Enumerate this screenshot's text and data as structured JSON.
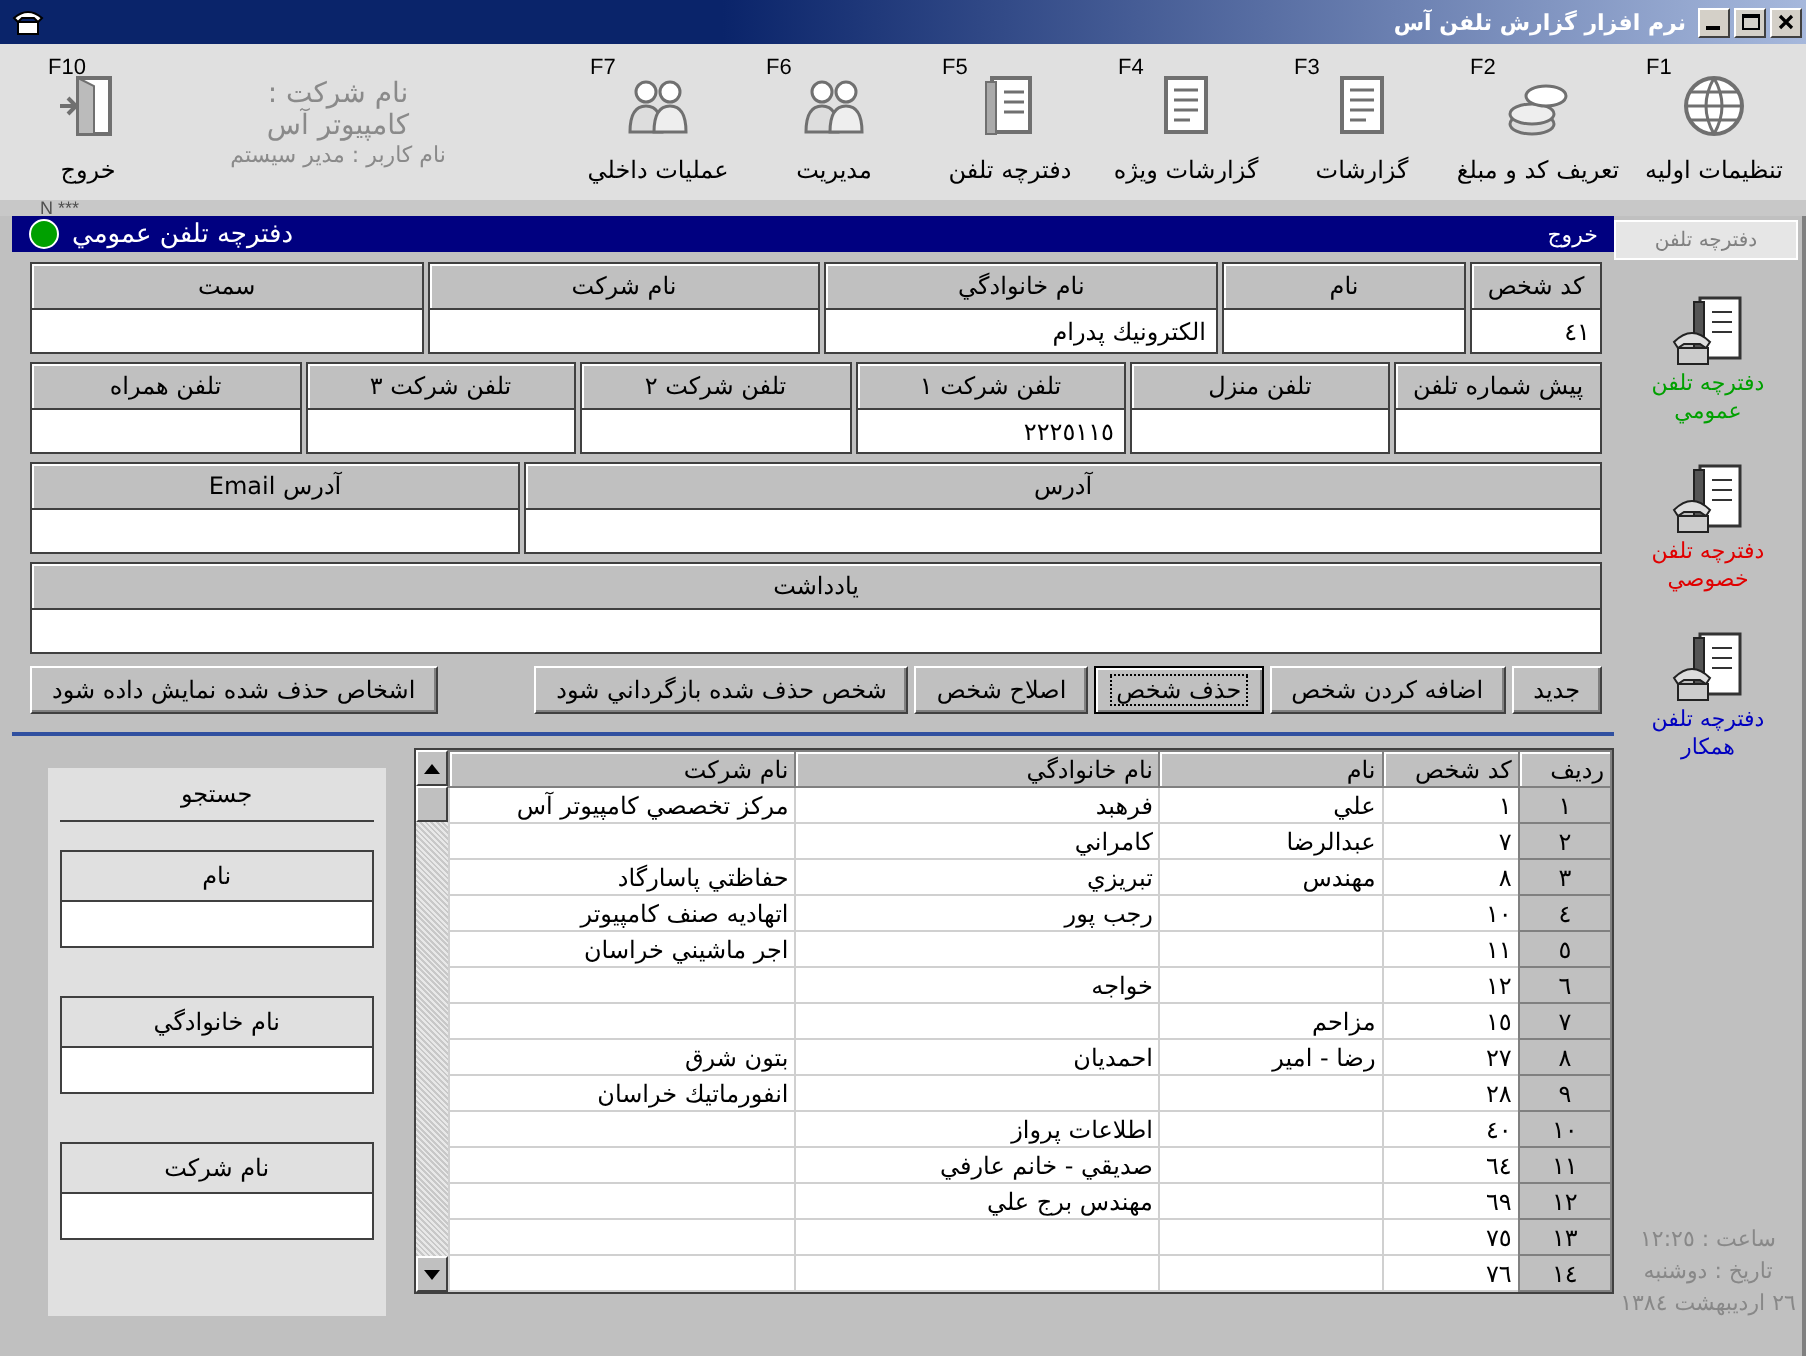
{
  "window": {
    "title": "نرم افزار گزارش تلفن آس"
  },
  "toolbar": {
    "items": [
      {
        "key": "F1",
        "label": "تنظيمات اوليه"
      },
      {
        "key": "F2",
        "label": "تعريف كد و مبلغ"
      },
      {
        "key": "F3",
        "label": "گزارشات"
      },
      {
        "key": "F4",
        "label": "گزارشات ويژه"
      },
      {
        "key": "F5",
        "label": "دفترچه تلفن"
      },
      {
        "key": "F6",
        "label": "مديريت"
      },
      {
        "key": "F7",
        "label": "عمليات داخلي"
      }
    ],
    "company_label": "نام شركت :",
    "company_name": "كامپيوتر آس",
    "user": "نام كاربر : مدير سيستم",
    "exit": {
      "key": "F10",
      "label": "خروج"
    }
  },
  "status_text": "*** N",
  "panel": {
    "title": "دفترچه تلفن عمومي",
    "exit": "خروج"
  },
  "form": {
    "groups": [
      {
        "fields": [
          {
            "label": "كد شخص",
            "value": "٤١"
          },
          {
            "label": "نام"
          },
          {
            "label": "نام خانوادگي",
            "value": "الكترونيك پدرام"
          },
          {
            "label": "نام شركت"
          },
          {
            "label": "سمت"
          }
        ]
      },
      {
        "fields": [
          {
            "label": "پيش شماره تلفن"
          },
          {
            "label": "تلفن منزل"
          },
          {
            "label": "تلفن شركت ١",
            "value": "٢٢٢٥١١٥"
          },
          {
            "label": "تلفن شركت ٢"
          },
          {
            "label": "تلفن شركت ٣"
          },
          {
            "label": "تلفن همراه"
          }
        ]
      },
      {
        "fields": [
          {
            "label": "آدرس"
          },
          {
            "label": "آدرس Email"
          }
        ]
      },
      {
        "fields": [
          {
            "label": "يادداشت"
          }
        ]
      }
    ]
  },
  "buttons": [
    {
      "label": "جديد",
      "focused": false
    },
    {
      "label": "اضافه كردن شخص",
      "focused": false
    },
    {
      "label": "حذف شخص",
      "focused": true
    },
    {
      "label": "اصلاح شخص",
      "focused": false
    },
    {
      "label": "شخص حذف شده بازگرداني شود",
      "focused": false
    },
    {
      "label": "اشخاص حذف شده نمايش داده شود",
      "focused": false
    }
  ],
  "table": {
    "columns": [
      "رديف",
      "كد شخص",
      "نام",
      "نام خانوادگي",
      "نام شركت"
    ],
    "rows": [
      {
        "n": "١",
        "code": "١",
        "first": "علي",
        "last": "فرهبد",
        "company": "مركز تخصصي كامپيوتر آس"
      },
      {
        "n": "٢",
        "code": "٧",
        "first": "عبدالرضا",
        "last": "كامراني"
      },
      {
        "n": "٣",
        "code": "٨",
        "first": "مهندس",
        "last": "تبريزي",
        "company": "حفاظتي پاسارگاد"
      },
      {
        "n": "٤",
        "code": "١٠",
        "last": "رجب پور",
        "company": "اتهاديه صنف كامپيوتر"
      },
      {
        "n": "٥",
        "code": "١١",
        "company": "اجر ماشيني خراسان"
      },
      {
        "n": "٦",
        "code": "١٢",
        "last": "خواجه"
      },
      {
        "n": "٧",
        "code": "١٥",
        "first": "مزاحم"
      },
      {
        "n": "٨",
        "code": "٢٧",
        "first": "رضا - امير",
        "last": "احمديان",
        "company": "بتون شرق"
      },
      {
        "n": "٩",
        "code": "٢٨",
        "company": "انفورماتيك خراسان"
      },
      {
        "n": "١٠",
        "code": "٤٠",
        "last": "اطلاعات پرواز"
      },
      {
        "n": "١١",
        "code": "٦٤",
        "last": "صديقي - خانم عارفي"
      },
      {
        "n": "١٢",
        "code": "٦٩",
        "last": "مهندس برج علي"
      },
      {
        "n": "١٣",
        "code": "٧٥"
      },
      {
        "n": "١٤",
        "code": "٧٦"
      }
    ]
  },
  "search": {
    "title": "جستجو",
    "fields": [
      "نام",
      "نام خانوادگي",
      "نام شركت"
    ]
  },
  "sidebar": {
    "title": "دفترچه تلفن",
    "items": [
      {
        "label": "دفترچه تلفن عمومي",
        "color": "#00a000"
      },
      {
        "label": "دفترچه تلفن خصوصي",
        "color": "#e00000"
      },
      {
        "label": "دفترچه تلفن همكار",
        "color": "#0000c0"
      }
    ],
    "time": "ساعت : ١٢:٢٥",
    "date": "تاريخ : دوشنبه",
    "date_full": "٢٦ ارديبهشت ١٣٨٤"
  }
}
